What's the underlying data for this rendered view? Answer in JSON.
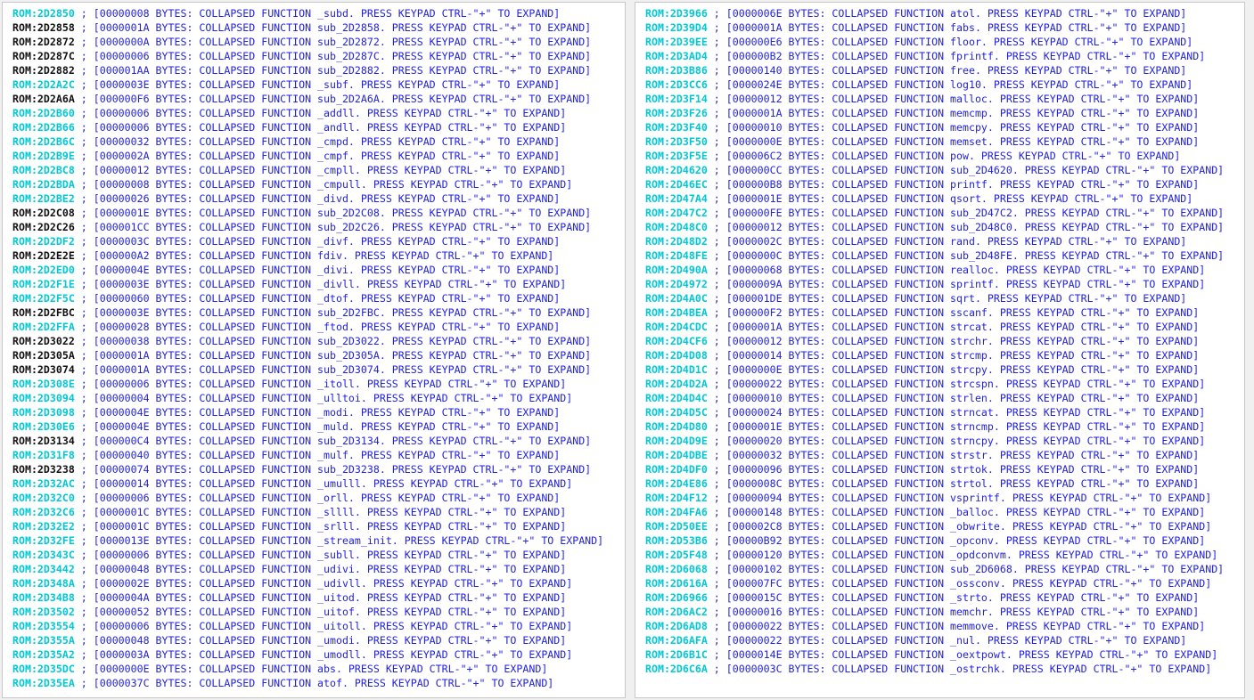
{
  "view": {
    "kind": "ida-disassembly-collapsed-functions",
    "address_prefix": "ROM:",
    "separator": ";",
    "collapsed_template_prefix": "[",
    "bytes_word": "BYTES:",
    "collapsed_word": "COLLAPSED FUNCTION",
    "expand_hint": "PRESS KEYPAD CTRL-\"+\" TO EXPAND]",
    "colors": {
      "named_address": "#00c8d4",
      "unnamed_address": "#111111",
      "body_text": "#2222e0",
      "pane_background": "#ffffff",
      "window_background": "#f0f0f0",
      "pane_border": "#c8c8c8"
    }
  },
  "panes": [
    {
      "name": "left-pane",
      "lines": [
        {
          "address": "ROM:2D2850",
          "size": "00000008",
          "func": "_subd",
          "named": true
        },
        {
          "address": "ROM:2D2858",
          "size": "0000001A",
          "func": "sub_2D2858",
          "named": false
        },
        {
          "address": "ROM:2D2872",
          "size": "0000000A",
          "func": "sub_2D2872",
          "named": false
        },
        {
          "address": "ROM:2D287C",
          "size": "00000006",
          "func": "sub_2D287C",
          "named": false
        },
        {
          "address": "ROM:2D2882",
          "size": "000001AA",
          "func": "sub_2D2882",
          "named": false
        },
        {
          "address": "ROM:2D2A2C",
          "size": "0000003E",
          "func": "_subf",
          "named": true
        },
        {
          "address": "ROM:2D2A6A",
          "size": "000000F6",
          "func": "sub_2D2A6A",
          "named": false
        },
        {
          "address": "ROM:2D2B60",
          "size": "00000006",
          "func": "_addll",
          "named": true
        },
        {
          "address": "ROM:2D2B66",
          "size": "00000006",
          "func": "_andll",
          "named": true
        },
        {
          "address": "ROM:2D2B6C",
          "size": "00000032",
          "func": "_cmpd",
          "named": true
        },
        {
          "address": "ROM:2D2B9E",
          "size": "0000002A",
          "func": "_cmpf",
          "named": true
        },
        {
          "address": "ROM:2D2BC8",
          "size": "00000012",
          "func": "_cmpll",
          "named": true
        },
        {
          "address": "ROM:2D2BDA",
          "size": "00000008",
          "func": "_cmpull",
          "named": true
        },
        {
          "address": "ROM:2D2BE2",
          "size": "00000026",
          "func": "_divd",
          "named": true
        },
        {
          "address": "ROM:2D2C08",
          "size": "0000001E",
          "func": "sub_2D2C08",
          "named": false
        },
        {
          "address": "ROM:2D2C26",
          "size": "000001CC",
          "func": "sub_2D2C26",
          "named": false
        },
        {
          "address": "ROM:2D2DF2",
          "size": "0000003C",
          "func": "_divf",
          "named": true
        },
        {
          "address": "ROM:2D2E2E",
          "size": "000000A2",
          "func": "fdiv",
          "named": false
        },
        {
          "address": "ROM:2D2ED0",
          "size": "0000004E",
          "func": "_divi",
          "named": true
        },
        {
          "address": "ROM:2D2F1E",
          "size": "0000003E",
          "func": "_divll",
          "named": true
        },
        {
          "address": "ROM:2D2F5C",
          "size": "00000060",
          "func": "_dtof",
          "named": true
        },
        {
          "address": "ROM:2D2FBC",
          "size": "0000003E",
          "func": "sub_2D2FBC",
          "named": false
        },
        {
          "address": "ROM:2D2FFA",
          "size": "00000028",
          "func": "_ftod",
          "named": true
        },
        {
          "address": "ROM:2D3022",
          "size": "00000038",
          "func": "sub_2D3022",
          "named": false
        },
        {
          "address": "ROM:2D305A",
          "size": "0000001A",
          "func": "sub_2D305A",
          "named": false
        },
        {
          "address": "ROM:2D3074",
          "size": "0000001A",
          "func": "sub_2D3074",
          "named": false
        },
        {
          "address": "ROM:2D308E",
          "size": "00000006",
          "func": "_itoll",
          "named": true
        },
        {
          "address": "ROM:2D3094",
          "size": "00000004",
          "func": "_ulltoi",
          "named": true
        },
        {
          "address": "ROM:2D3098",
          "size": "0000004E",
          "func": "_modi",
          "named": true
        },
        {
          "address": "ROM:2D30E6",
          "size": "0000004E",
          "func": "_muld",
          "named": true
        },
        {
          "address": "ROM:2D3134",
          "size": "000000C4",
          "func": "sub_2D3134",
          "named": false
        },
        {
          "address": "ROM:2D31F8",
          "size": "00000040",
          "func": "_mulf",
          "named": true
        },
        {
          "address": "ROM:2D3238",
          "size": "00000074",
          "func": "sub_2D3238",
          "named": false
        },
        {
          "address": "ROM:2D32AC",
          "size": "00000014",
          "func": "_umulll",
          "named": true
        },
        {
          "address": "ROM:2D32C0",
          "size": "00000006",
          "func": "_orll",
          "named": true
        },
        {
          "address": "ROM:2D32C6",
          "size": "0000001C",
          "func": "_sllll",
          "named": true
        },
        {
          "address": "ROM:2D32E2",
          "size": "0000001C",
          "func": "_srlll",
          "named": true
        },
        {
          "address": "ROM:2D32FE",
          "size": "0000013E",
          "func": "_stream_init",
          "named": true
        },
        {
          "address": "ROM:2D343C",
          "size": "00000006",
          "func": "_subll",
          "named": true
        },
        {
          "address": "ROM:2D3442",
          "size": "00000048",
          "func": "_udivi",
          "named": true
        },
        {
          "address": "ROM:2D348A",
          "size": "0000002E",
          "func": "_udivll",
          "named": true
        },
        {
          "address": "ROM:2D34B8",
          "size": "0000004A",
          "func": "_uitod",
          "named": true
        },
        {
          "address": "ROM:2D3502",
          "size": "00000052",
          "func": "_uitof",
          "named": true
        },
        {
          "address": "ROM:2D3554",
          "size": "00000006",
          "func": "_uitoll",
          "named": true
        },
        {
          "address": "ROM:2D355A",
          "size": "00000048",
          "func": "_umodi",
          "named": true
        },
        {
          "address": "ROM:2D35A2",
          "size": "0000003A",
          "func": "_umodll",
          "named": true
        },
        {
          "address": "ROM:2D35DC",
          "size": "0000000E",
          "func": "abs",
          "named": true
        },
        {
          "address": "ROM:2D35EA",
          "size": "0000037C",
          "func": "atof",
          "named": true
        }
      ]
    },
    {
      "name": "right-pane",
      "lines": [
        {
          "address": "ROM:2D3966",
          "size": "0000006E",
          "func": "atol",
          "named": true
        },
        {
          "address": "ROM:2D39D4",
          "size": "0000001A",
          "func": "fabs",
          "named": true
        },
        {
          "address": "ROM:2D39EE",
          "size": "000000E6",
          "func": "floor",
          "named": true
        },
        {
          "address": "ROM:2D3AD4",
          "size": "000000B2",
          "func": "fprintf",
          "named": true
        },
        {
          "address": "ROM:2D3B86",
          "size": "00000140",
          "func": "free",
          "named": true
        },
        {
          "address": "ROM:2D3CC6",
          "size": "0000024E",
          "func": "log10",
          "named": true
        },
        {
          "address": "ROM:2D3F14",
          "size": "00000012",
          "func": "malloc",
          "named": true
        },
        {
          "address": "ROM:2D3F26",
          "size": "0000001A",
          "func": "memcmp",
          "named": true
        },
        {
          "address": "ROM:2D3F40",
          "size": "00000010",
          "func": "memcpy",
          "named": true
        },
        {
          "address": "ROM:2D3F50",
          "size": "0000000E",
          "func": "memset",
          "named": true
        },
        {
          "address": "ROM:2D3F5E",
          "size": "000006C2",
          "func": "pow",
          "named": true
        },
        {
          "address": "ROM:2D4620",
          "size": "000000CC",
          "func": "sub_2D4620",
          "named": true
        },
        {
          "address": "ROM:2D46EC",
          "size": "000000B8",
          "func": "printf",
          "named": true
        },
        {
          "address": "ROM:2D47A4",
          "size": "0000001E",
          "func": "qsort",
          "named": true
        },
        {
          "address": "ROM:2D47C2",
          "size": "000000FE",
          "func": "sub_2D47C2",
          "named": true
        },
        {
          "address": "ROM:2D48C0",
          "size": "00000012",
          "func": "sub_2D48C0",
          "named": true
        },
        {
          "address": "ROM:2D48D2",
          "size": "0000002C",
          "func": "rand",
          "named": true
        },
        {
          "address": "ROM:2D48FE",
          "size": "0000000C",
          "func": "sub_2D48FE",
          "named": true
        },
        {
          "address": "ROM:2D490A",
          "size": "00000068",
          "func": "realloc",
          "named": true
        },
        {
          "address": "ROM:2D4972",
          "size": "0000009A",
          "func": "sprintf",
          "named": true
        },
        {
          "address": "ROM:2D4A0C",
          "size": "000001DE",
          "func": "sqrt",
          "named": true
        },
        {
          "address": "ROM:2D4BEA",
          "size": "000000F2",
          "func": "sscanf",
          "named": true
        },
        {
          "address": "ROM:2D4CDC",
          "size": "0000001A",
          "func": "strcat",
          "named": true
        },
        {
          "address": "ROM:2D4CF6",
          "size": "00000012",
          "func": "strchr",
          "named": true
        },
        {
          "address": "ROM:2D4D08",
          "size": "00000014",
          "func": "strcmp",
          "named": true
        },
        {
          "address": "ROM:2D4D1C",
          "size": "0000000E",
          "func": "strcpy",
          "named": true
        },
        {
          "address": "ROM:2D4D2A",
          "size": "00000022",
          "func": "strcspn",
          "named": true
        },
        {
          "address": "ROM:2D4D4C",
          "size": "00000010",
          "func": "strlen",
          "named": true
        },
        {
          "address": "ROM:2D4D5C",
          "size": "00000024",
          "func": "strncat",
          "named": true
        },
        {
          "address": "ROM:2D4D80",
          "size": "0000001E",
          "func": "strncmp",
          "named": true
        },
        {
          "address": "ROM:2D4D9E",
          "size": "00000020",
          "func": "strncpy",
          "named": true
        },
        {
          "address": "ROM:2D4DBE",
          "size": "00000032",
          "func": "strstr",
          "named": true
        },
        {
          "address": "ROM:2D4DF0",
          "size": "00000096",
          "func": "strtok",
          "named": true
        },
        {
          "address": "ROM:2D4E86",
          "size": "0000008C",
          "func": "strtol",
          "named": true
        },
        {
          "address": "ROM:2D4F12",
          "size": "00000094",
          "func": "vsprintf",
          "named": true
        },
        {
          "address": "ROM:2D4FA6",
          "size": "00000148",
          "func": "_balloc",
          "named": true
        },
        {
          "address": "ROM:2D50EE",
          "size": "000002C8",
          "func": "_obwrite",
          "named": true
        },
        {
          "address": "ROM:2D53B6",
          "size": "00000B92",
          "func": "_opconv",
          "named": true
        },
        {
          "address": "ROM:2D5F48",
          "size": "00000120",
          "func": "_opdconvm",
          "named": true
        },
        {
          "address": "ROM:2D6068",
          "size": "00000102",
          "func": "sub_2D6068",
          "named": true
        },
        {
          "address": "ROM:2D616A",
          "size": "000007FC",
          "func": "_ossconv",
          "named": true
        },
        {
          "address": "ROM:2D6966",
          "size": "0000015C",
          "func": "_strto",
          "named": true
        },
        {
          "address": "ROM:2D6AC2",
          "size": "00000016",
          "func": "memchr",
          "named": true
        },
        {
          "address": "ROM:2D6AD8",
          "size": "00000022",
          "func": "memmove",
          "named": true
        },
        {
          "address": "ROM:2D6AFA",
          "size": "00000022",
          "func": "_nul",
          "named": true
        },
        {
          "address": "ROM:2D6B1C",
          "size": "0000014E",
          "func": "_oextpowt",
          "named": true
        },
        {
          "address": "ROM:2D6C6A",
          "size": "0000003C",
          "func": "_ostrchk",
          "named": true
        }
      ]
    }
  ]
}
